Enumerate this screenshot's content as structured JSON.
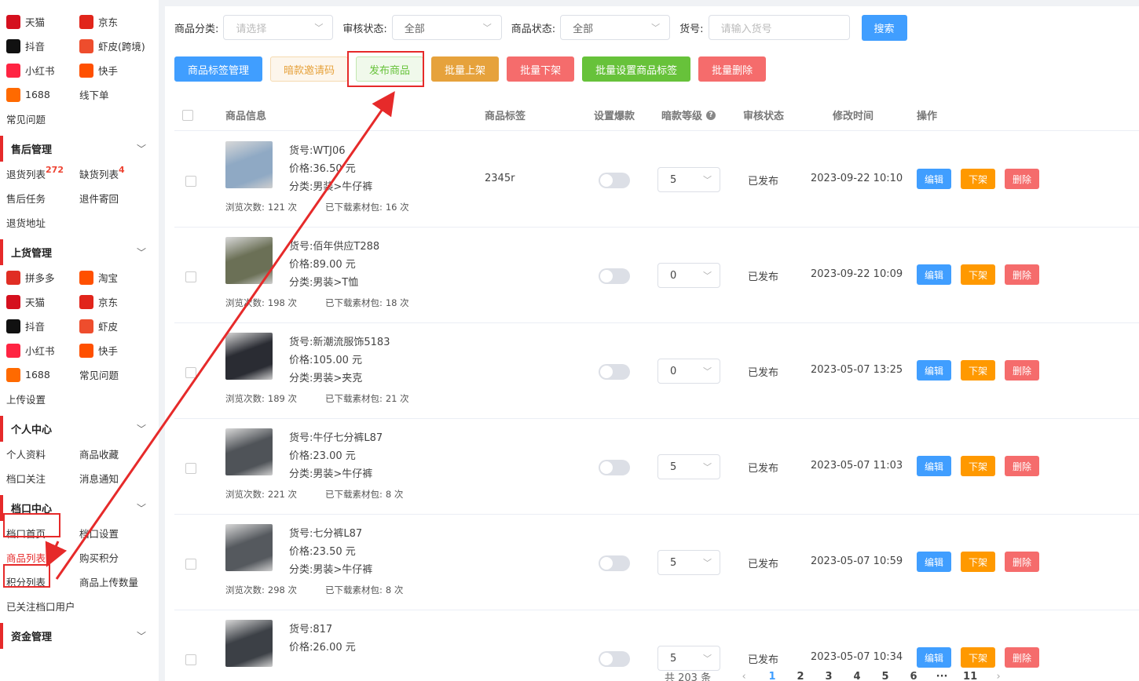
{
  "sidebar": {
    "top_platforms": [
      {
        "label": "天猫",
        "icon": "tmall-icon",
        "color": "#d5101e",
        "sup": ""
      },
      {
        "label": "京东",
        "icon": "jd-icon",
        "color": "#e1251b",
        "sup": ""
      },
      {
        "label": "抖音",
        "icon": "douyin-icon",
        "color": "#111111",
        "sup": ""
      },
      {
        "label": "虾皮(跨境)",
        "icon": "shopee-icon",
        "color": "#ee4d2d",
        "sup": ""
      },
      {
        "label": "小红书",
        "icon": "xiaohongshu-icon",
        "color": "#ff2442",
        "sup": ""
      },
      {
        "label": "快手",
        "icon": "kuaishou-icon",
        "color": "#ff5000",
        "sup": ""
      },
      {
        "label": "1688",
        "icon": "1688-icon",
        "color": "#ff6a00",
        "sup": ""
      },
      {
        "label": "线下单",
        "icon": "",
        "color": "",
        "sup": ""
      }
    ],
    "faq_label": "常见问题",
    "sections": [
      {
        "title": "售后管理",
        "items": [
          {
            "label": "退货列表",
            "icon": "",
            "color": "",
            "sup": "272"
          },
          {
            "label": "缺货列表",
            "icon": "",
            "color": "",
            "sup": "4"
          },
          {
            "label": "售后任务",
            "icon": "",
            "color": "",
            "sup": ""
          },
          {
            "label": "退件寄回",
            "icon": "",
            "color": "",
            "sup": ""
          },
          {
            "label": "退货地址",
            "icon": "",
            "color": "",
            "sup": ""
          }
        ]
      },
      {
        "title": "上货管理",
        "items": [
          {
            "label": "拼多多",
            "icon": "pinduoduo-icon",
            "color": "#e02e24",
            "sup": ""
          },
          {
            "label": "淘宝",
            "icon": "taobao-icon",
            "color": "#ff5000",
            "sup": ""
          },
          {
            "label": "天猫",
            "icon": "tmall-icon",
            "color": "#d5101e",
            "sup": ""
          },
          {
            "label": "京东",
            "icon": "jd-icon",
            "color": "#e1251b",
            "sup": ""
          },
          {
            "label": "抖音",
            "icon": "douyin-icon",
            "color": "#111111",
            "sup": ""
          },
          {
            "label": "虾皮",
            "icon": "shopee-icon",
            "color": "#ee4d2d",
            "sup": ""
          },
          {
            "label": "小红书",
            "icon": "xiaohongshu-icon",
            "color": "#ff2442",
            "sup": ""
          },
          {
            "label": "快手",
            "icon": "kuaishou-icon",
            "color": "#ff5000",
            "sup": ""
          },
          {
            "label": "1688",
            "icon": "1688-icon",
            "color": "#ff6a00",
            "sup": ""
          },
          {
            "label": "常见问题",
            "icon": "",
            "color": "",
            "sup": ""
          },
          {
            "label": "上传设置",
            "icon": "",
            "color": "",
            "sup": ""
          }
        ]
      },
      {
        "title": "个人中心",
        "items": [
          {
            "label": "个人资料",
            "icon": "",
            "color": "",
            "sup": ""
          },
          {
            "label": "商品收藏",
            "icon": "",
            "color": "",
            "sup": ""
          },
          {
            "label": "档口关注",
            "icon": "",
            "color": "",
            "sup": ""
          },
          {
            "label": "消息通知",
            "icon": "",
            "color": "",
            "sup": ""
          }
        ]
      },
      {
        "title": "档口中心",
        "items": [
          {
            "label": "档口首页",
            "icon": "",
            "color": "",
            "sup": ""
          },
          {
            "label": "档口设置",
            "icon": "",
            "color": "",
            "sup": ""
          },
          {
            "label": "商品列表",
            "icon": "",
            "color": "",
            "sup": "",
            "active": true
          },
          {
            "label": "购买积分",
            "icon": "",
            "color": "",
            "sup": ""
          },
          {
            "label": "积分列表",
            "icon": "",
            "color": "",
            "sup": ""
          },
          {
            "label": "商品上传数量",
            "icon": "",
            "color": "",
            "sup": ""
          },
          {
            "label": "已关注档口用户",
            "icon": "",
            "color": "",
            "sup": ""
          }
        ]
      },
      {
        "title": "资金管理",
        "items": []
      }
    ]
  },
  "filters": {
    "category_label": "商品分类:",
    "category_placeholder": "请选择",
    "review_label": "审核状态:",
    "review_value": "全部",
    "status_label": "商品状态:",
    "status_value": "全部",
    "sku_label": "货号:",
    "sku_placeholder": "请输入货号",
    "search_label": "搜索"
  },
  "actions": [
    {
      "label": "商品标签管理",
      "bg": "#409eff",
      "fg": "#ffffff",
      "border": "#409eff"
    },
    {
      "label": "暗款邀请码",
      "bg": "#fdf6ec",
      "fg": "#e6a23c",
      "border": "#f5dab1"
    },
    {
      "label": "发布商品",
      "bg": "#f0f9eb",
      "fg": "#67c23a",
      "border": "#c2e7b0"
    },
    {
      "label": "批量上架",
      "bg": "#e6a23c",
      "fg": "#ffffff",
      "border": "#e6a23c"
    },
    {
      "label": "批量下架",
      "bg": "#f56c6c",
      "fg": "#ffffff",
      "border": "#f56c6c"
    },
    {
      "label": "批量设置商品标签",
      "bg": "#67c23a",
      "fg": "#ffffff",
      "border": "#67c23a"
    },
    {
      "label": "批量删除",
      "bg": "#f56c6c",
      "fg": "#ffffff",
      "border": "#f56c6c"
    }
  ],
  "table": {
    "headers": {
      "info": "商品信息",
      "tag": "商品标签",
      "hot": "设置爆款",
      "level": "暗款等级",
      "review": "审核状态",
      "modified": "修改时间",
      "ops": "操作"
    },
    "sku_prefix": "货号:",
    "price_prefix": "价格:",
    "category_prefix": "分类:",
    "views_prefix": "浏览次数:",
    "downloads_prefix": "已下载素材包:",
    "edit_label": "编辑",
    "off_label": "下架",
    "delete_label": "删除",
    "rows": [
      {
        "sku": "WTJ06",
        "price": "36.50 元",
        "category": "男装>牛仔裤",
        "views": "121 次",
        "downloads": "16 次",
        "tag": "2345r",
        "level": "5",
        "status": "已发布",
        "time": "2023-09-22 10:10",
        "thumb_color": "#8fa9c4"
      },
      {
        "sku": "佰年供应T288",
        "price": "89.00 元",
        "category": "男装>T恤",
        "views": "198 次",
        "downloads": "18 次",
        "tag": "",
        "level": "0",
        "status": "已发布",
        "time": "2023-09-22 10:09",
        "thumb_color": "#6b7056"
      },
      {
        "sku": "新潮流服饰5183",
        "price": "105.00 元",
        "category": "男装>夹克",
        "views": "189 次",
        "downloads": "21 次",
        "tag": "",
        "level": "0",
        "status": "已发布",
        "time": "2023-05-07 13:25",
        "thumb_color": "#2a2c33"
      },
      {
        "sku": "牛仔七分裤L87",
        "price": "23.00 元",
        "category": "男装>牛仔裤",
        "views": "221 次",
        "downloads": "8 次",
        "tag": "",
        "level": "5",
        "status": "已发布",
        "time": "2023-05-07 11:03",
        "thumb_color": "#4f5358"
      },
      {
        "sku": "七分裤L87",
        "price": "23.50 元",
        "category": "男装>牛仔裤",
        "views": "298 次",
        "downloads": "8 次",
        "tag": "",
        "level": "5",
        "status": "已发布",
        "time": "2023-05-07 10:59",
        "thumb_color": "#55595e"
      },
      {
        "sku": "817",
        "price": "26.00 元",
        "category": "",
        "views": "",
        "downloads": "",
        "tag": "",
        "level": "5",
        "status": "已发布",
        "time": "2023-05-07 10:34",
        "thumb_color": "#3c4046"
      }
    ]
  },
  "pager": {
    "total": "共 203 条",
    "pages": [
      "1",
      "2",
      "3",
      "4",
      "5",
      "6",
      "···",
      "11"
    ],
    "active": "1",
    "prev": "‹",
    "next": "›"
  },
  "colors": {
    "edit": "#409eff",
    "off": "#ff9900",
    "delete": "#f56c6c",
    "annotation": "#e62a2a"
  }
}
